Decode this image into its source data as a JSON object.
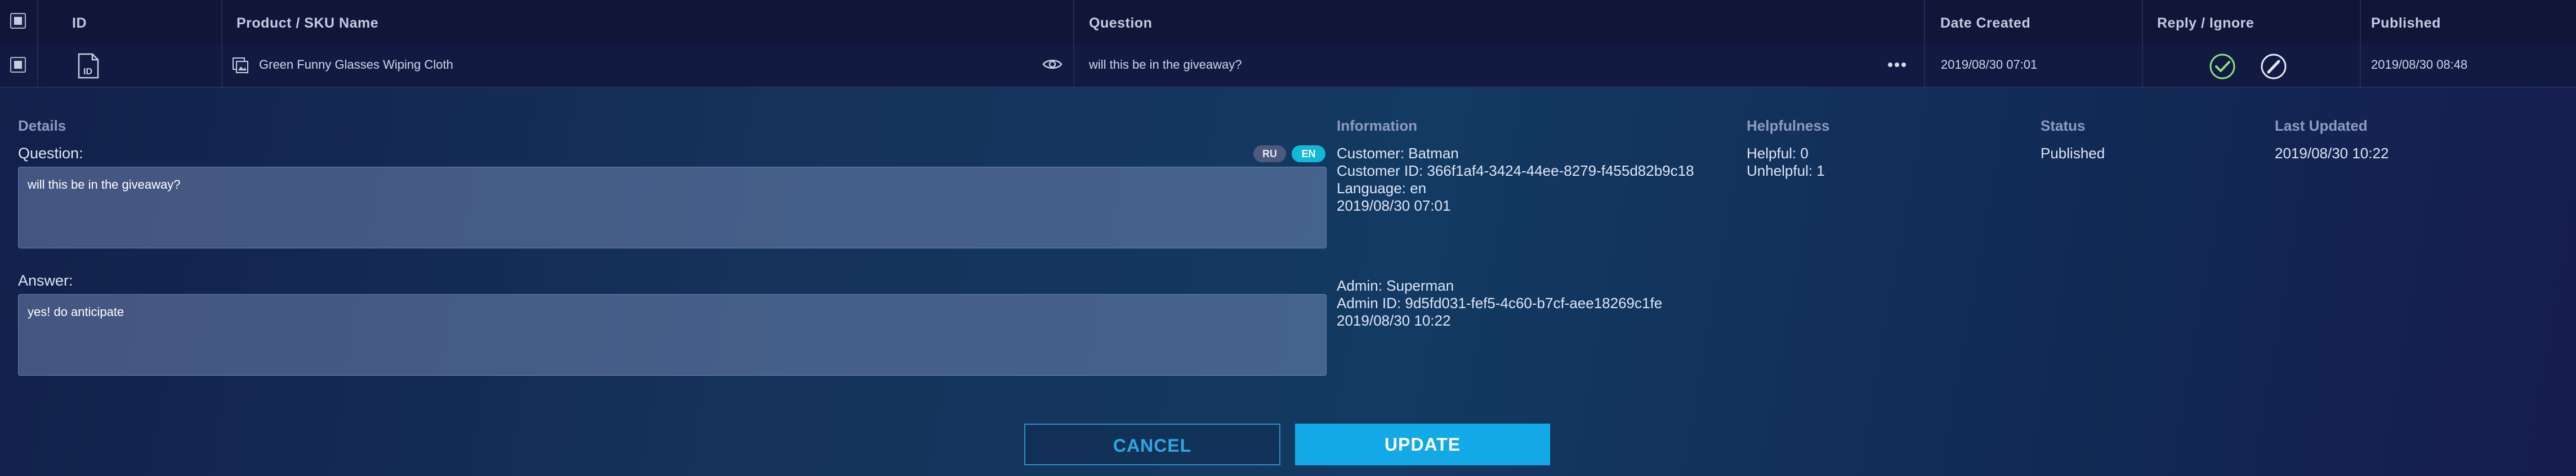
{
  "table": {
    "columns": [
      "ID",
      "Product / SKU Name",
      "Question",
      "Date Created",
      "Reply / Ignore",
      "Published"
    ],
    "row": {
      "id_icon": "id-card-icon",
      "product_name": "Green Funny Glasses Wiping Cloth",
      "question": "will this be in the giveaway?",
      "date_created": "2019/08/30 07:01",
      "published": "2019/08/30 08:48"
    }
  },
  "details": {
    "heading": "Details",
    "question_label": "Question:",
    "question_value": "will this be in the giveaway?",
    "answer_label": "Answer:",
    "answer_value": "yes! do anticipate",
    "languages": [
      "RU",
      "EN"
    ],
    "active_language": "EN"
  },
  "information": {
    "heading": "Information",
    "customer": "Customer: Batman",
    "customer_id": "Customer ID: 366f1af4-3424-44ee-8279-f455d82b9c18",
    "language": "Language: en",
    "question_date": "2019/08/30 07:01",
    "admin": "Admin: Superman",
    "admin_id": "Admin ID: 9d5fd031-fef5-4c60-b7cf-aee18269c1fe",
    "answer_date": "2019/08/30 10:22"
  },
  "helpfulness": {
    "heading": "Helpfulness",
    "helpful": "Helpful: 0",
    "unhelpful": "Unhelpful: 1"
  },
  "status": {
    "heading": "Status",
    "value": "Published"
  },
  "last_updated": {
    "heading": "Last Updated",
    "value": "2019/08/30 10:22"
  },
  "actions": {
    "cancel": "CANCEL",
    "update": "UPDATE"
  },
  "colors": {
    "accent": "#12a9e6",
    "active_lang": "#12b8d6",
    "check_green": "#8ee07a"
  }
}
